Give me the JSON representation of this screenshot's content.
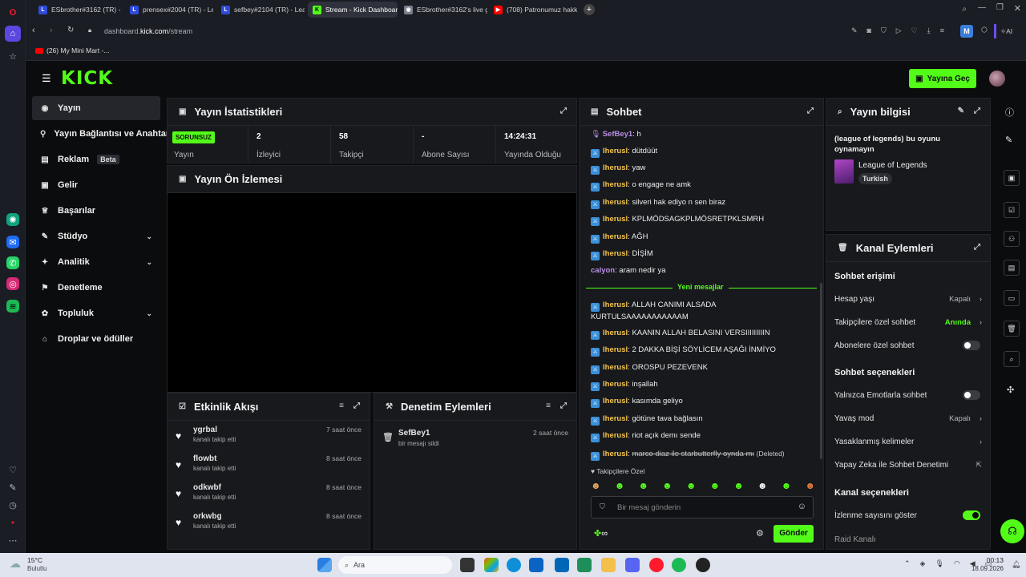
{
  "browser": {
    "tabs": [
      {
        "label": "ESbrother#3162 (TR) - Lea",
        "fav": "L",
        "color": "#2f4bd9"
      },
      {
        "label": "prensex#2004 (TR) - Leag",
        "fav": "L",
        "color": "#2f4bd9"
      },
      {
        "label": "sefbey#2104 (TR) - League",
        "fav": "L",
        "color": "#2f4bd9"
      },
      {
        "label": "Stream - Kick Dashboard",
        "fav": "K",
        "color": "#53fc18"
      },
      {
        "label": "ESbrother#3162's live gam",
        "fav": "◉",
        "color": "#7a7f8c"
      },
      {
        "label": "(708) Patronumuz hakkınd",
        "fav": "▶",
        "color": "#ff0000"
      }
    ],
    "add_tab": "+",
    "url_prefix": "dashboard.",
    "url_domain": "kick.com",
    "url_path": "/stream",
    "bookmark": "(26) My Mini Mart -...",
    "profile_letter": "M",
    "ai_label": "AI"
  },
  "header": {
    "logo": "KICK",
    "go_live": "Yayına Geç"
  },
  "nav": {
    "items": [
      {
        "label": "Yayın",
        "icon": "◉"
      },
      {
        "label": "Yayın Bağlantısı ve Anahtar",
        "icon": "⚲"
      },
      {
        "label": "Reklam",
        "icon": "▤",
        "badge": "Beta"
      },
      {
        "label": "Gelir",
        "icon": "▣"
      },
      {
        "label": "Başarılar",
        "icon": "♕"
      },
      {
        "label": "Stüdyo",
        "icon": "✎"
      },
      {
        "label": "Analitik",
        "icon": "✦"
      },
      {
        "label": "Denetleme",
        "icon": "⚑"
      },
      {
        "label": "Topluluk",
        "icon": "✿"
      },
      {
        "label": "Droplar ve ödüller",
        "icon": "⌂"
      }
    ]
  },
  "stats": {
    "title": "Yayın İstatistikleri",
    "status_badge": "SORUNSUZ",
    "status_label": "Yayın",
    "viewers_value": "2",
    "viewers_label": "İzleyici",
    "followers_value": "58",
    "followers_label": "Takipçi",
    "subs_value": "-",
    "subs_label": "Abone Sayısı",
    "uptime_value": "14:24:31",
    "uptime_label": "Yayında Olduğu"
  },
  "preview": {
    "title": "Yayın Ön İzlemesi"
  },
  "activity": {
    "title": "Etkinlik Akışı",
    "items": [
      {
        "user": "ygrbal",
        "action": "kanalı takip etti",
        "time": "7 saat önce"
      },
      {
        "user": "flowbt",
        "action": "kanalı takip etti",
        "time": "8 saat önce"
      },
      {
        "user": "odkwbf",
        "action": "kanalı takip etti",
        "time": "8 saat önce"
      },
      {
        "user": "orkwbg",
        "action": "kanalı takip etti",
        "time": "8 saat önce"
      }
    ]
  },
  "moderation": {
    "title": "Denetim Eylemleri",
    "items": [
      {
        "user": "SefBey1",
        "action": "bir mesajı sildi",
        "time": "2 saat önce"
      }
    ]
  },
  "chat": {
    "title": "Sohbet",
    "messages": [
      {
        "user": "SefBey1",
        "text": "h"
      },
      {
        "user": "Iherusl",
        "text": "dütdüüt"
      },
      {
        "user": "Iherusl",
        "text": "yaw"
      },
      {
        "user": "Iherusl",
        "text": "o engage ne amk"
      },
      {
        "user": "Iherusl",
        "text": "silveri hak ediyo n sen biraz"
      },
      {
        "user": "Iherusl",
        "text": "KPLMÖDSAGKPLMÖSRETPKLSMRH"
      },
      {
        "user": "Iherusl",
        "text": "AĞH"
      },
      {
        "user": "Iherusl",
        "text": "DİŞİM"
      },
      {
        "user": "calyon",
        "text": "aram nedir ya"
      },
      {
        "user": "Iherusl",
        "text": "ALLAH CANIMI ALSADA KURTULSAAAAAAAAAAAM"
      },
      {
        "user": "Iherusl",
        "text": "KAANIN ALLAH BELASINI VERSIIIIIIIIIN"
      },
      {
        "user": "Iherusl",
        "text": "2 DAKKA BİŞİ SÖYLİCEM AŞAĞI İNMİYO"
      },
      {
        "user": "Iherusl",
        "text": "OROSPU PEZEVENK"
      },
      {
        "user": "Iherusl",
        "text": "inşallah"
      },
      {
        "user": "Iherusl",
        "text": "kasımda geliyo"
      },
      {
        "user": "Iherusl",
        "text": "götüne tava bağlasın"
      },
      {
        "user": "Iherusl",
        "text": "riot açık demı sende"
      },
      {
        "user": "Iherusl",
        "text": "marco diaz ile starbutterfly oynda mı",
        "deleted": "(Deleted)"
      }
    ],
    "new_messages": "Yeni mesajlar",
    "followers_only": "Takipçilere Özel",
    "input_placeholder": "Bir mesaj gönderin",
    "send": "Gönder"
  },
  "stream_info": {
    "title": "Yayın bilgisi",
    "stream_title": "(league of legends) bu oyunu oynamayın",
    "category": "League of Legends",
    "language": "Turkish"
  },
  "channel": {
    "title": "Kanal Eylemleri",
    "chat_access": "Sohbet erişimi",
    "account_age": "Hesap yaşı",
    "account_age_val": "Kapalı",
    "followers_chat": "Takipçilere özel sohbet",
    "followers_chat_val": "Anında",
    "subs_chat": "Abonelere özel sohbet",
    "chat_options": "Sohbet seçenekleri",
    "emote_only": "Yalnızca Emotlarla sohbet",
    "slow_mode": "Yavaş mod",
    "slow_mode_val": "Kapalı",
    "banned_words": "Yasaklanmış kelimeler",
    "ai_mod": "Yapay Zeka ile Sohbet Denetimi",
    "channel_options": "Kanal seçenekleri",
    "show_views": "İzlenme sayısını göster",
    "raid": "Raid Kanalı"
  },
  "taskbar": {
    "temp": "15°C",
    "weather": "Bulutlu",
    "search": "Ara",
    "time": "00:13",
    "date": "18.09.2026"
  },
  "colors": {
    "brand": "#53fc18",
    "bg": "#0b0c0e",
    "panel": "#18191d",
    "mod_badge": "#3a8fd9"
  }
}
